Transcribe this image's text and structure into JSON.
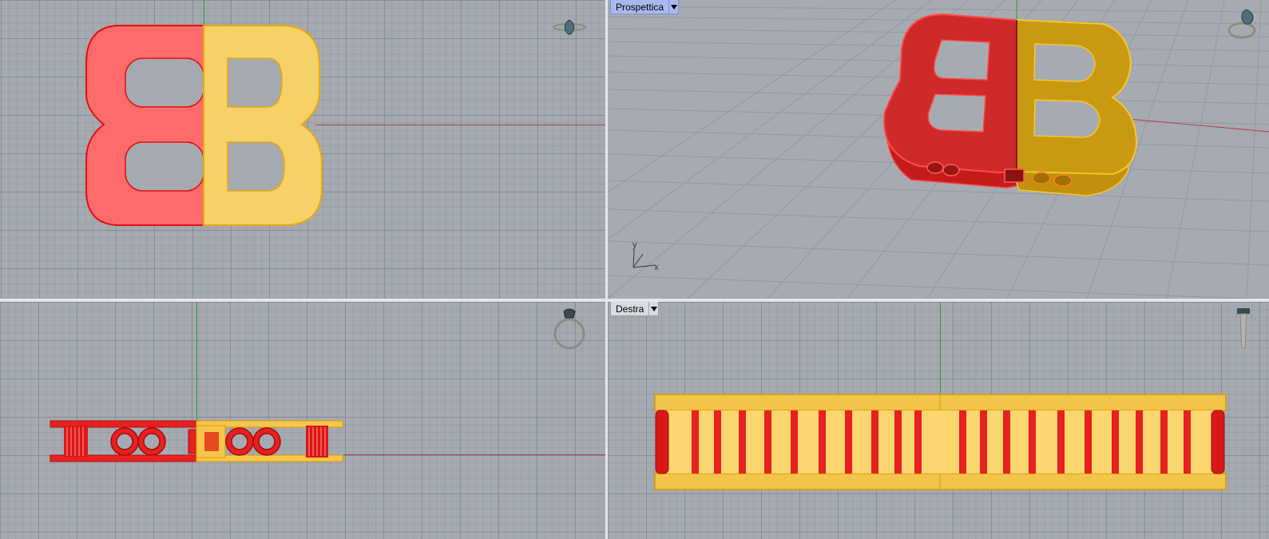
{
  "viewports": {
    "top": {
      "title": ""
    },
    "perspective": {
      "title": "Prospettica",
      "active": true
    },
    "front": {
      "title": ""
    },
    "right": {
      "title": "Destra"
    }
  },
  "axis_labels": {
    "x": "x",
    "y": "y"
  },
  "colors": {
    "red_object": "#ff6b6b",
    "red_outline": "#e31010",
    "yellow_object": "#f6d167",
    "yellow_outline": "#e9a70d",
    "grid_background": "#a5aab1",
    "x_axis": "#b3403f",
    "y_axis": "#2c9a2c",
    "active_label": "#a9b9ee"
  },
  "icons": {
    "top_nav": "ring-gem-top-icon",
    "persp_nav": "ring-perspective-icon",
    "front_nav": "ring-front-icon",
    "right_nav": "ring-side-icon",
    "dropdown": "chevron-down-icon"
  }
}
